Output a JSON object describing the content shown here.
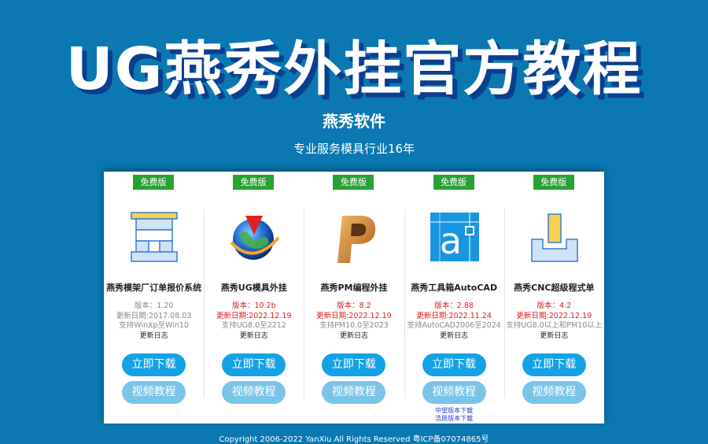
{
  "header": {
    "title": "UG燕秀外挂官方教程",
    "brand": "燕秀软件",
    "slogan": "专业服务模具行业16年"
  },
  "products": [
    {
      "badge": "免费版",
      "icon": "mold-frame-icon",
      "name": "燕秀模架厂订单报价系统",
      "version": "版本：1.20",
      "updated": "更新日期:2017.08.03",
      "support": "支持WinXp至Win10",
      "changelog": "更新日志",
      "download": "立即下载",
      "video": "视频教程"
    },
    {
      "badge": "免费版",
      "icon": "ug-globe-icon",
      "name": "燕秀UG模具外挂",
      "version": "版本：10.2b",
      "updated": "更新日期:2022.12.19",
      "support": "支持UG8.0至2212",
      "changelog": "更新日志",
      "download": "立即下载",
      "video": "视频教程"
    },
    {
      "badge": "免费版",
      "icon": "pm-logo-icon",
      "name": "燕秀PM编程外挂",
      "version": "版本：8.2",
      "updated": "更新日期:2022.12.19",
      "support": "支持PM10.0至2023",
      "changelog": "更新日志",
      "download": "立即下载",
      "video": "视频教程"
    },
    {
      "badge": "免费版",
      "icon": "autocad-a-icon",
      "name": "燕秀工具箱AutoCAD",
      "version": "版本：2.88",
      "updated": "更新日期:2022.11.24",
      "support": "支持AutoCAD2006至2024",
      "changelog": "更新日志",
      "download": "立即下载",
      "video": "视频教程",
      "links": [
        "中望版本下载",
        "浩辰版本下载"
      ]
    },
    {
      "badge": "免费版",
      "icon": "cnc-block-icon",
      "name": "燕秀CNC超级程式单",
      "version": "版本：4.2",
      "updated": "更新日期:2022.12.19",
      "support": "支持UG8.0以上和PM10以上",
      "changelog": "更新日志",
      "download": "立即下载",
      "video": "视频教程"
    }
  ],
  "footer": {
    "copyright": "Copyright 2006-2022 YanXiu All Rights Reserved 粤ICP备07074865号"
  },
  "colors": {
    "background": "#0b78b2",
    "badge_green": "#27a334",
    "download_blue": "#13a2e6",
    "video_blue": "#7ac4ea",
    "highlight_red": "#e21b1b"
  }
}
